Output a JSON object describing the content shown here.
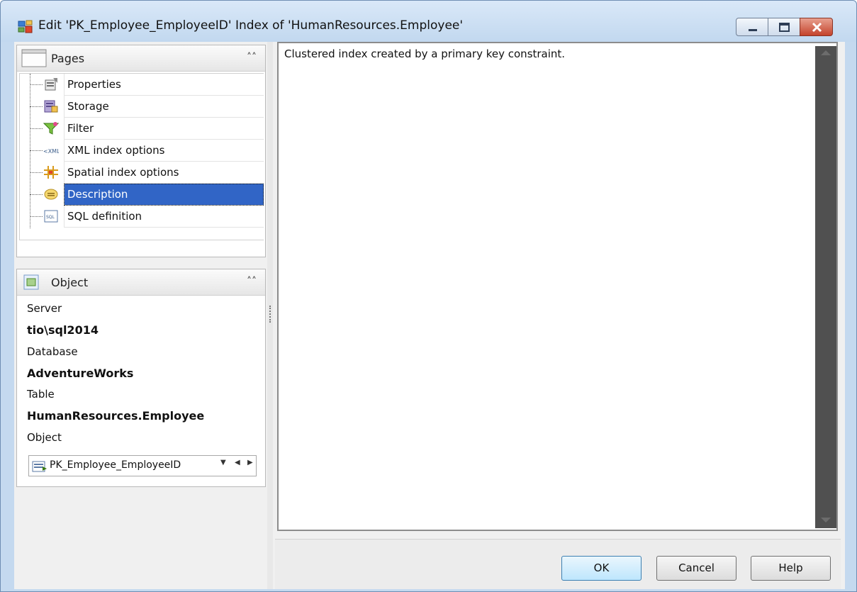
{
  "window": {
    "title": "Edit 'PK_Employee_EmployeeID' Index of 'HumanResources.Employee'",
    "icon": "index-edit-icon"
  },
  "pages_panel": {
    "title": "Pages",
    "items": [
      {
        "label": "Properties",
        "icon": "properties-icon"
      },
      {
        "label": "Storage",
        "icon": "storage-icon"
      },
      {
        "label": "Filter",
        "icon": "filter-icon"
      },
      {
        "label": "XML index options",
        "icon": "xml-icon"
      },
      {
        "label": "Spatial index options",
        "icon": "spatial-grid-icon"
      },
      {
        "label": "Description",
        "icon": "description-icon",
        "selected": true
      },
      {
        "label": "SQL definition",
        "icon": "sql-icon"
      }
    ]
  },
  "object_panel": {
    "title": "Object",
    "server_label": "Server",
    "server_value": "tio\\sql2014",
    "database_label": "Database",
    "database_value": "AdventureWorks",
    "table_label": "Table",
    "table_value": "HumanResources.Employee",
    "object_label": "Object",
    "object_value": "PK_Employee_EmployeeID"
  },
  "editor": {
    "text": "Clustered index created by a primary key constraint."
  },
  "buttons": {
    "ok": "OK",
    "cancel": "Cancel",
    "help": "Help"
  },
  "colors": {
    "selection": "#3165c6",
    "title_bar": "#c4d9ef",
    "close_button": "#c4432c"
  }
}
